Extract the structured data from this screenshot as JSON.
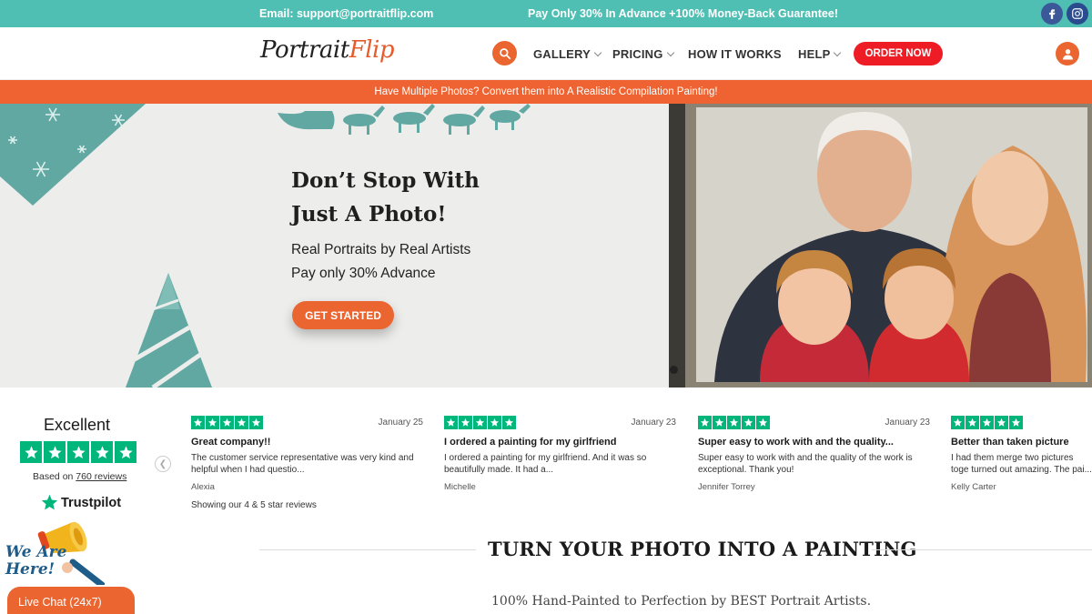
{
  "topbar": {
    "email": "Email: support@portraitflip.com",
    "promo": "Pay Only 30% In Advance +100% Money-Back Guarantee!",
    "social": [
      "facebook-icon",
      "instagram-icon"
    ]
  },
  "header": {
    "logo": {
      "part1": "Portrait",
      "part2": "Flip"
    },
    "nav": [
      {
        "label": "GALLERY",
        "dropdown": true
      },
      {
        "label": "PRICING",
        "dropdown": true
      },
      {
        "label": "HOW IT WORKS",
        "dropdown": false
      },
      {
        "label": "HELP",
        "dropdown": true
      }
    ],
    "order_button": "ORDER NOW"
  },
  "strip": {
    "text": "Have Multiple Photos? Convert them into A Realistic Compilation Painting!"
  },
  "hero": {
    "title_line1": "Don’t Stop With",
    "title_line2": "Just A Photo!",
    "sub_line1": "Real Portraits by Real Artists",
    "sub_line2": "Pay only 30% Advance",
    "cta": "GET STARTED"
  },
  "trustpilot": {
    "rating_word": "Excellent",
    "based_on_prefix": "Based on ",
    "review_count": "760 reviews",
    "brand": "Trustpilot",
    "showing": "Showing our 4 & 5 star reviews",
    "stars": 5
  },
  "reviews": [
    {
      "stars": 5,
      "date": "January 25",
      "title": "Great company!!",
      "body": "The customer service representative was very kind and helpful when I had questio...",
      "author": "Alexia"
    },
    {
      "stars": 5,
      "date": "January 23",
      "title": "I ordered a painting for my girlfriend",
      "body": "I ordered a painting for my girlfriend. And it was so beautifully made. It had a...",
      "author": "Michelle"
    },
    {
      "stars": 5,
      "date": "January 23",
      "title": "Super easy to work with and the quality...",
      "body": "Super easy to work with and the quality of the work is exceptional. Thank you!",
      "author": "Jennifer Torrey"
    },
    {
      "stars": 5,
      "date": "",
      "title": "Better than taken picture",
      "body": "I had them merge two pictures toge turned out amazing. The pai...",
      "author": "Kelly Carter"
    }
  ],
  "section": {
    "title": "TURN YOUR PHOTO INTO A PAINTING",
    "subtitle": "100% Hand-Painted to Perfection by BEST Portrait Artists."
  },
  "chat": {
    "tagline_line1": "We Are",
    "tagline_line2": "Here!",
    "button": "Live Chat (24x7)"
  },
  "colors": {
    "teal": "#4fbfb3",
    "orange": "#ea6530",
    "red": "#ee1c24",
    "trustpilot_green": "#00b67a"
  }
}
